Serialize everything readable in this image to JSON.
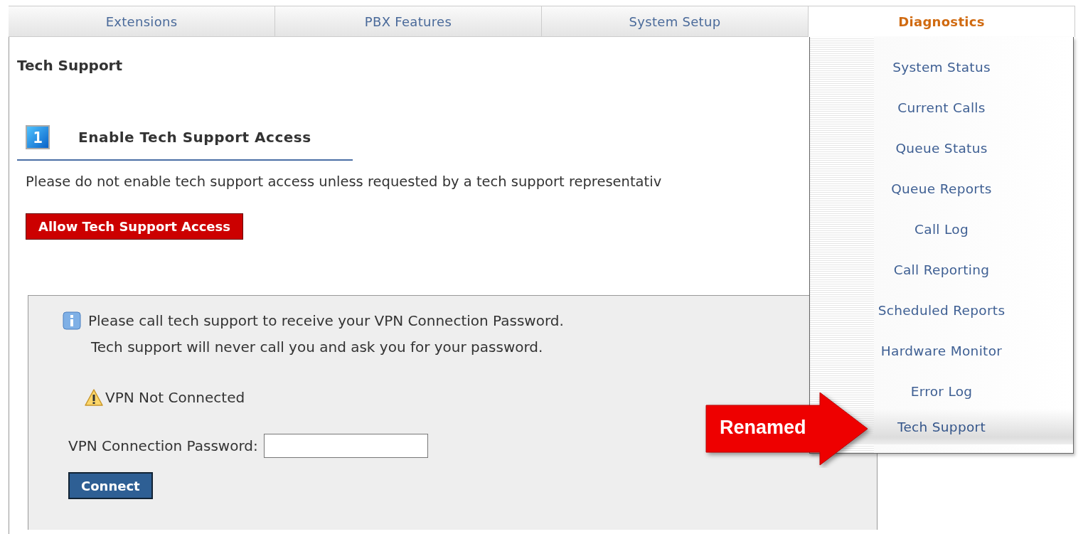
{
  "tabs": [
    {
      "label": "Extensions",
      "selected": false
    },
    {
      "label": "PBX Features",
      "selected": false
    },
    {
      "label": "System Setup",
      "selected": false
    },
    {
      "label": "Diagnostics",
      "selected": true
    }
  ],
  "page_title": "Tech Support",
  "step": {
    "number": "1",
    "title": "Enable Tech Support Access"
  },
  "warning_text": "Please do not enable tech support access unless requested by a tech support representativ",
  "allow_button": "Allow Tech Support Access",
  "vpn_box": {
    "info_lines": [
      "Please call tech support to receive your VPN Connection Password.",
      "Tech support will never call you and ask you for your password."
    ],
    "status": "VPN Not Connected",
    "password_label": "VPN Connection Password:",
    "connect_button": "Connect"
  },
  "menu": {
    "items": [
      {
        "label": "System Status",
        "selected": false
      },
      {
        "label": "Current Calls",
        "selected": false
      },
      {
        "label": "Queue Status",
        "selected": false
      },
      {
        "label": "Queue Reports",
        "selected": false
      },
      {
        "label": "Call Log",
        "selected": false
      },
      {
        "label": "Call Reporting",
        "selected": false
      },
      {
        "label": "Scheduled Reports",
        "selected": false
      },
      {
        "label": "Hardware Monitor",
        "selected": false
      },
      {
        "label": "Error Log",
        "selected": false
      },
      {
        "label": "Tech Support",
        "selected": true
      }
    ]
  },
  "callout": {
    "label": "Renamed"
  }
}
